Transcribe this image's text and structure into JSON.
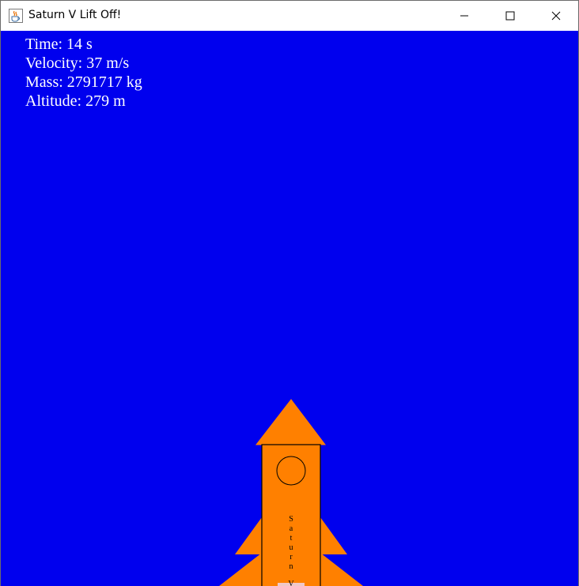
{
  "window": {
    "title": "Saturn V Lift Off!",
    "icon": "java-cup-icon"
  },
  "controls": {
    "minimize_icon": "minimize-icon",
    "maximize_icon": "maximize-icon",
    "close_icon": "close-icon"
  },
  "hud": {
    "time": "Time: 14 s",
    "velocity": "Velocity: 37 m/s",
    "mass": "Mass: 2791717 kg",
    "altitude": "Altitude: 279 m"
  },
  "rocket": {
    "label_letters": [
      "S",
      "a",
      "t",
      "u",
      "r",
      "n",
      "V"
    ],
    "body_color": "#ff8000",
    "outline_color": "#000000"
  },
  "colors": {
    "sky": "#0000ee",
    "hud_text": "#ffffff"
  }
}
